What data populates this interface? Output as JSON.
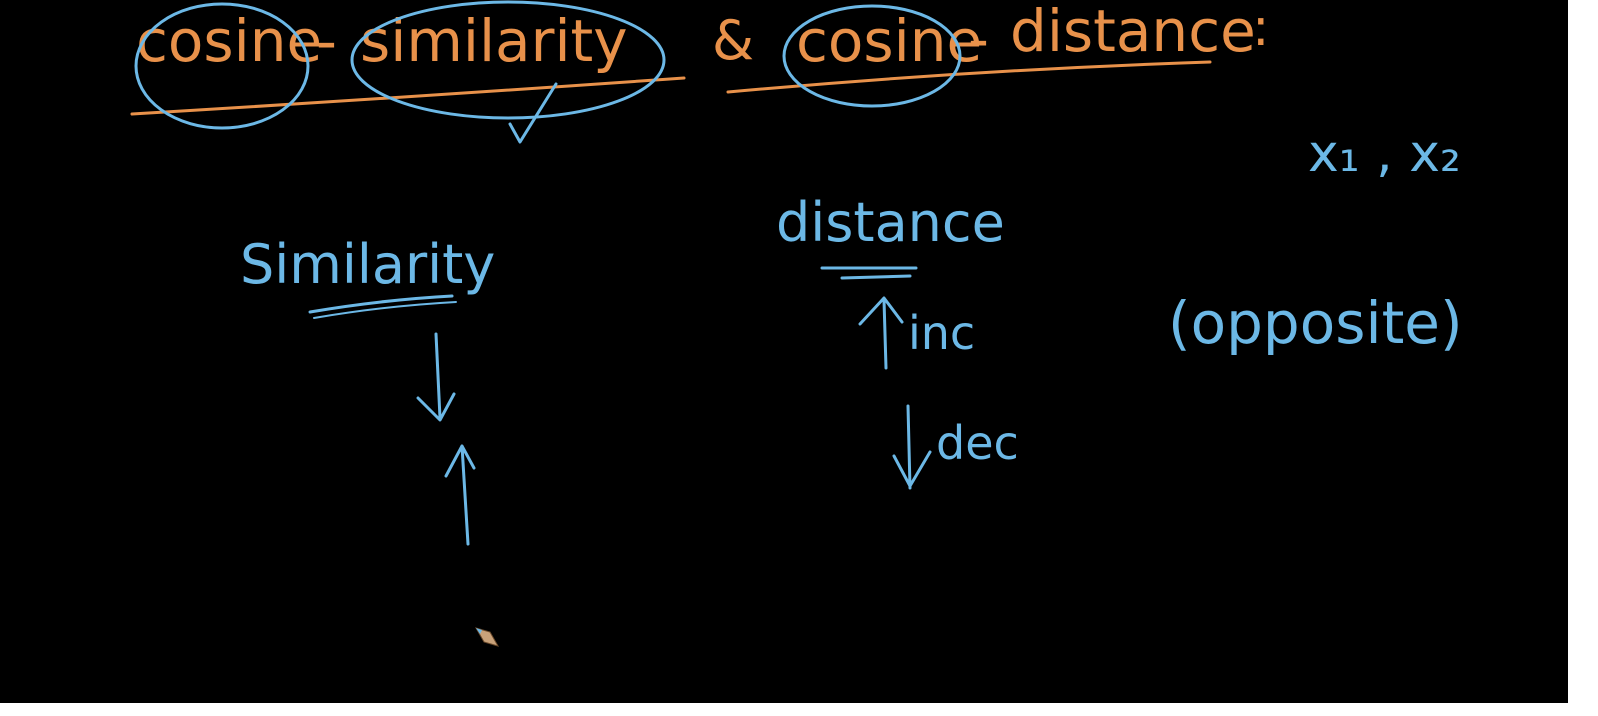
{
  "colors": {
    "background": "#000000",
    "orange_ink": "#e8914a",
    "blue_ink": "#6cb8e6"
  },
  "heading": {
    "word1": "cosine",
    "dash1": "-",
    "word2": "similarity",
    "amp": "&",
    "word3": "cosine",
    "dash2": "-",
    "word4": "distance",
    "colon": ":"
  },
  "notes": {
    "vectors": "x₁ , x₂",
    "similarity": "Similarity",
    "distance": "distance",
    "inc_label": "inc",
    "dec_label": "dec",
    "opposite": "(opposite)"
  },
  "icons": {
    "cursor": "pencil-cursor-icon"
  }
}
